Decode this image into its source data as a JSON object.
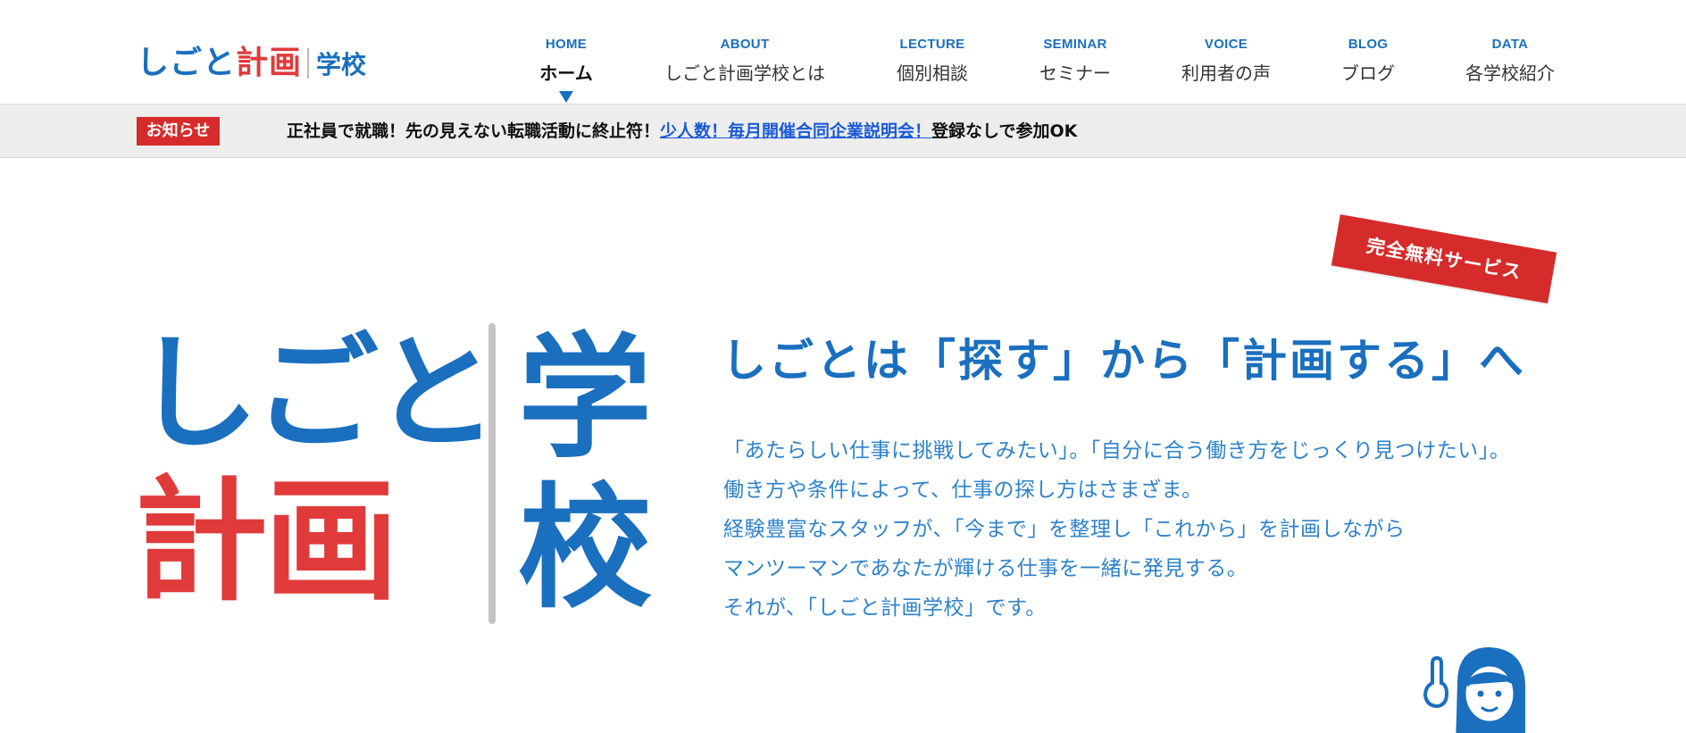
{
  "header": {
    "logo": {
      "part1": "しごと",
      "part2": "計画",
      "sub": "学校"
    },
    "nav": [
      {
        "en": "HOME",
        "ja": "ホーム",
        "active": true
      },
      {
        "en": "ABOUT",
        "ja": "しごと計画学校とは",
        "active": false
      },
      {
        "en": "LECTURE",
        "ja": "個別相談",
        "active": false
      },
      {
        "en": "SEMINAR",
        "ja": "セミナー",
        "active": false
      },
      {
        "en": "VOICE",
        "ja": "利用者の声",
        "active": false
      },
      {
        "en": "BLOG",
        "ja": "ブログ",
        "active": false
      },
      {
        "en": "DATA",
        "ja": "各学校紹介",
        "active": false
      }
    ]
  },
  "news": {
    "badge": "お知らせ",
    "text_before": "正社員で就職！先の見えない転職活動に終止符！",
    "link": "少人数！毎月開催合同企業説明会！",
    "text_after": "登録なしで参加OK"
  },
  "hero": {
    "logo_row1": "しごと",
    "logo_row2": "計画",
    "logo_gaku": "学",
    "logo_kou": "校",
    "free_badge": "完全無料サービス",
    "tagline": "しごとは「探す」から「計画する」へ",
    "body": [
      "「あたらしい仕事に挑戦してみたい」。「自分に合う働き方をじっくり見つけたい」。",
      "働き方や条件によって、仕事の探し方はさまざま。",
      "経験豊富なスタッフが、「今まで」を整理し「これから」を計画しながら",
      "マンツーマンであなたが輝ける仕事を一緒に発見する。",
      "それが、「しごと計画学校」です。"
    ]
  },
  "colors": {
    "brand_blue": "#1a6fbf",
    "brand_red": "#e03a3a",
    "badge_red": "#d62b2b",
    "link_blue": "#1a5ad6",
    "newsbar_bg": "#ededed"
  },
  "icons": {
    "nav_active": "triangle-down-icon",
    "character": "woman-pointing-illustration"
  }
}
